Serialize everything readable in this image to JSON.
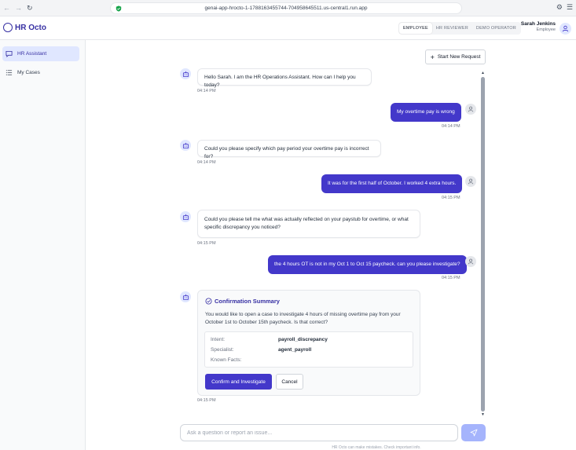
{
  "browser": {
    "url": "genai-app-hrocto-1-1788163455744-704958645511.us-central1.run.app",
    "nav_icons": [
      "back-icon",
      "forward-icon",
      "reload-icon"
    ]
  },
  "app": {
    "title": "HR Octo",
    "roles": [
      "EMPLOYEE",
      "HR REVIEWER",
      "DEMO OPERATOR"
    ],
    "active_role": "EMPLOYEE",
    "user_name": "Sarah Jenkins",
    "user_role": "Employee",
    "accent": "#4338ca"
  },
  "sidebar": {
    "items": [
      {
        "label": "HR Assistant",
        "icon": "chat-icon",
        "active": true
      },
      {
        "label": "My Cases",
        "icon": "list-icon",
        "active": false
      }
    ]
  },
  "main": {
    "new_request_label": "Start New Request"
  },
  "messages": [
    {
      "sender": "bot",
      "text": "Hello Sarah. I am the HR Operations Assistant. How can I help you today?",
      "time": "04:14 PM"
    },
    {
      "sender": "user",
      "text": "My overtime pay is wrong",
      "time": "04:14 PM"
    },
    {
      "sender": "bot",
      "text": "Could you please specify which pay period your overtime pay is incorrect for?",
      "time": "04:14 PM"
    },
    {
      "sender": "user",
      "text": "It was for the first half of October. I worked 4 extra hours.",
      "time": "04:15 PM"
    },
    {
      "sender": "bot",
      "text_line1": "Could you please tell me what was actually reflected on your paystub for overtime, or what",
      "text_line2": "specific discrepancy you noticed?",
      "time": "04:15 PM"
    },
    {
      "sender": "user",
      "text": "the 4 hours OT is not in my Oct 1 to Oct 15 paycheck. can you please investigate?",
      "time": "04:15 PM"
    }
  ],
  "confirmation": {
    "title": "Confirmation Summary",
    "desc_line1": "You would like to open a case to investigate 4 hours of missing overtime pay from your",
    "desc_line2": "October 1st to October 15th paycheck. Is that correct?",
    "facts": [
      {
        "label": "Intent:",
        "value": "payroll_discrepancy"
      },
      {
        "label": "Specialist:",
        "value": "agent_payroll"
      },
      {
        "label": "Known Facts:",
        "value": ""
      }
    ],
    "confirm_label": "Confirm and Investigate",
    "cancel_label": "Cancel",
    "time": "04:15 PM"
  },
  "input": {
    "placeholder": "Ask a question or report an issue..."
  },
  "disclaimer": "HR Octo can make mistakes. Check important info."
}
